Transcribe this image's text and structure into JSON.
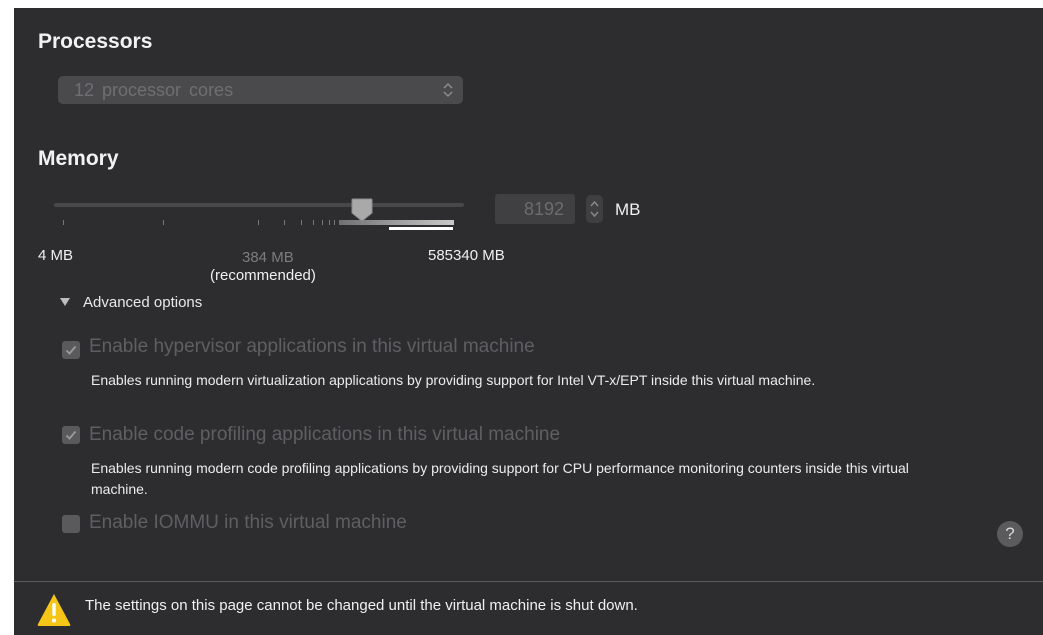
{
  "processors": {
    "heading": "Processors",
    "selected": "12  processor cores"
  },
  "memory": {
    "heading": "Memory",
    "value": "8192",
    "unit": "MB",
    "min_label": "4 MB",
    "recommended_value": "384 MB",
    "recommended_label": "(recommended)",
    "max_label": "585340 MB",
    "slider_fraction": 0.74
  },
  "advanced": {
    "toggle_label": "Advanced options",
    "options": [
      {
        "label": "Enable hypervisor applications in this virtual machine",
        "checked": true,
        "description": "Enables running modern virtualization applications by providing support for Intel VT-x/EPT inside this virtual machine."
      },
      {
        "label": "Enable code profiling applications in this virtual machine",
        "checked": true,
        "description": "Enables running modern code profiling applications by providing support for CPU performance monitoring counters inside this virtual machine."
      },
      {
        "label": "Enable IOMMU in this virtual machine",
        "checked": false
      }
    ]
  },
  "help_label": "?",
  "footer": {
    "warning": "The settings on this page cannot be changed until the virtual machine is shut down."
  },
  "colors": {
    "panel_bg": "#2d2d30",
    "warning": "#f5c518"
  }
}
